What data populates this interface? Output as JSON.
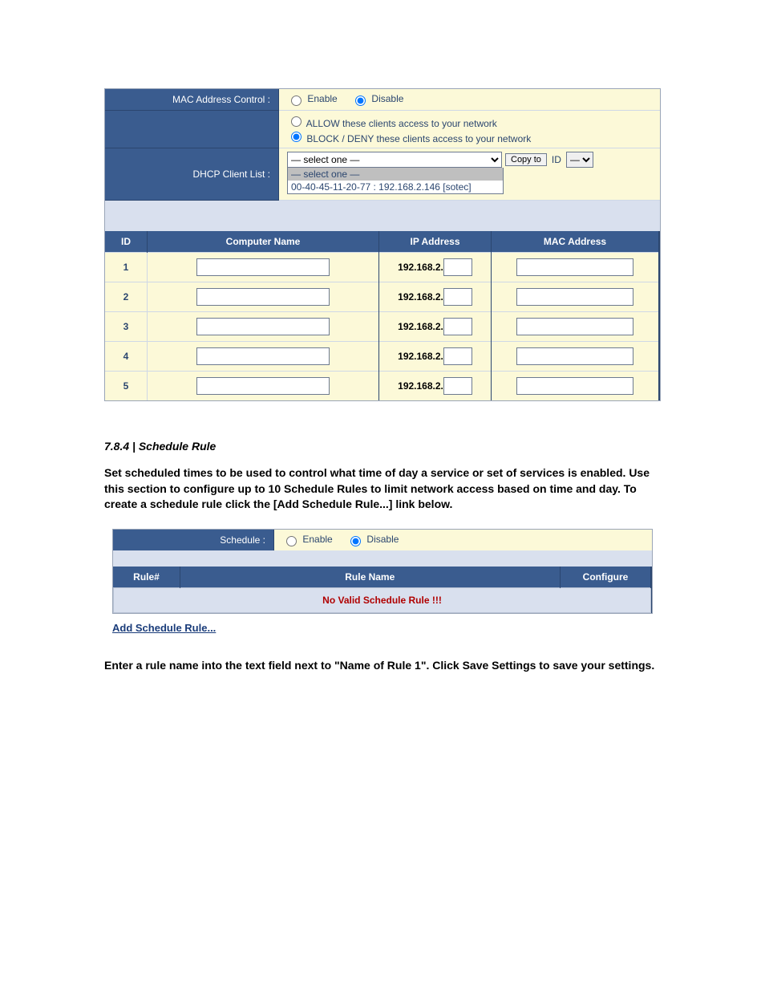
{
  "mac_control": {
    "label": "MAC Address Control :",
    "enable": "Enable",
    "disable": "Disable",
    "selected": "disable",
    "policy_allow": "ALLOW these clients access to your network",
    "policy_block": "BLOCK / DENY these clients access to your network",
    "policy_selected": "block"
  },
  "dhcp": {
    "label": "DHCP Client List :",
    "select_placeholder": "— select one —",
    "options": [
      "— select one —",
      "00-40-45-11-20-77 : 192.168.2.146 [sotec]"
    ],
    "copy_btn": "Copy to",
    "id_label": "ID",
    "id_placeholder": "—"
  },
  "grid": {
    "headers": {
      "id": "ID",
      "name": "Computer Name",
      "ip": "IP Address",
      "mac": "MAC Address"
    },
    "ip_prefix": "192.168.2.",
    "rows": [
      {
        "id": "1",
        "name": "",
        "ip_last": "",
        "mac": ""
      },
      {
        "id": "2",
        "name": "",
        "ip_last": "",
        "mac": ""
      },
      {
        "id": "3",
        "name": "",
        "ip_last": "",
        "mac": ""
      },
      {
        "id": "4",
        "name": "",
        "ip_last": "",
        "mac": ""
      },
      {
        "id": "5",
        "name": "",
        "ip_last": "",
        "mac": ""
      }
    ]
  },
  "section": {
    "heading": "7.8.4 | Schedule Rule",
    "intro": "Set scheduled times to be used to control what time of day a service or set of services is enabled. Use this section to configure up to 10 Schedule Rules to limit network access based on time and day. To create a schedule rule click the [Add Schedule Rule...] link below."
  },
  "schedule": {
    "label": "Schedule :",
    "enable": "Enable",
    "disable": "Disable",
    "selected": "disable",
    "headers": {
      "rule_no": "Rule#",
      "rule_name": "Rule Name",
      "configure": "Configure"
    },
    "empty_msg": "No Valid Schedule Rule !!!",
    "add_link": "Add Schedule Rule..."
  },
  "outro": "Enter a rule name into the text field next to \"Name of Rule 1\". Click Save Settings to save your settings."
}
